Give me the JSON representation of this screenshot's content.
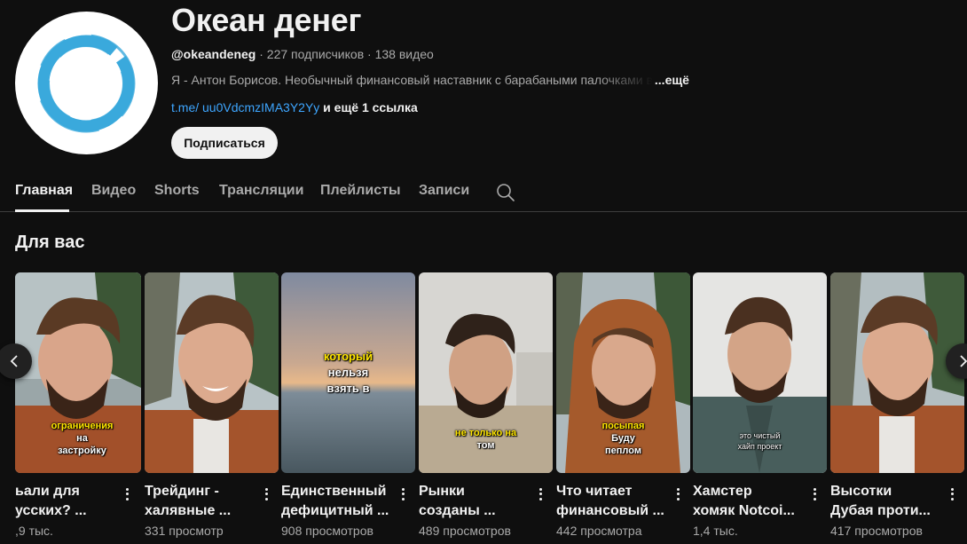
{
  "channel": {
    "title": "Океан денег",
    "handle": "@okeandeneg",
    "stats": " · 227 подписчиков · 138 видео",
    "description": "Я - Антон Борисов. Необычный финансовый наставник с барабаными палочками в",
    "more_label": "...ещё",
    "link": "t.me/ uu0VdcmzIMA3Y2Yy",
    "extra_links": " и ещё 1 ссылка",
    "subscribe_label": "Подписаться",
    "avatar_color": "#3aa9dc"
  },
  "tabs": [
    "Главная",
    "Видео",
    "Shorts",
    "Трансляции",
    "Плейлисты",
    "Записи"
  ],
  "active_tab": "Главная",
  "section_title": "Для вас",
  "cards": [
    {
      "title1": "ьали для",
      "title2": "усских? ...",
      "views": ",9 тыс.",
      "cap_hl": "ограничения",
      "cap": "на",
      "cap2": "застройку"
    },
    {
      "title1": "Трейдинг -",
      "title2": "халявные ...",
      "views": "331 просмотр"
    },
    {
      "title1": "Единственный",
      "title2": "дефицитный ...",
      "views": "908 просмотров",
      "cap_hl": "который",
      "cap": "нельзя",
      "cap2": "взять в"
    },
    {
      "title1": "Рынки",
      "title2": "созданы ...",
      "views": "489 просмотров",
      "cap_hl": "не только на",
      "cap": "том"
    },
    {
      "title1": "Что читает",
      "title2": "финансовый ...",
      "views": "442 просмотра",
      "cap_hl": "посыпая",
      "cap": "Буду",
      "cap2": "пеплом"
    },
    {
      "title1": "Хамстер",
      "title2": "хомяк Notcoi...",
      "views": "1,4 тыс.",
      "cap": "это чистый",
      "cap2": "хайп проект"
    },
    {
      "title1": "Высотки",
      "title2": "Дубая проти...",
      "views": "417 просмотров"
    }
  ]
}
